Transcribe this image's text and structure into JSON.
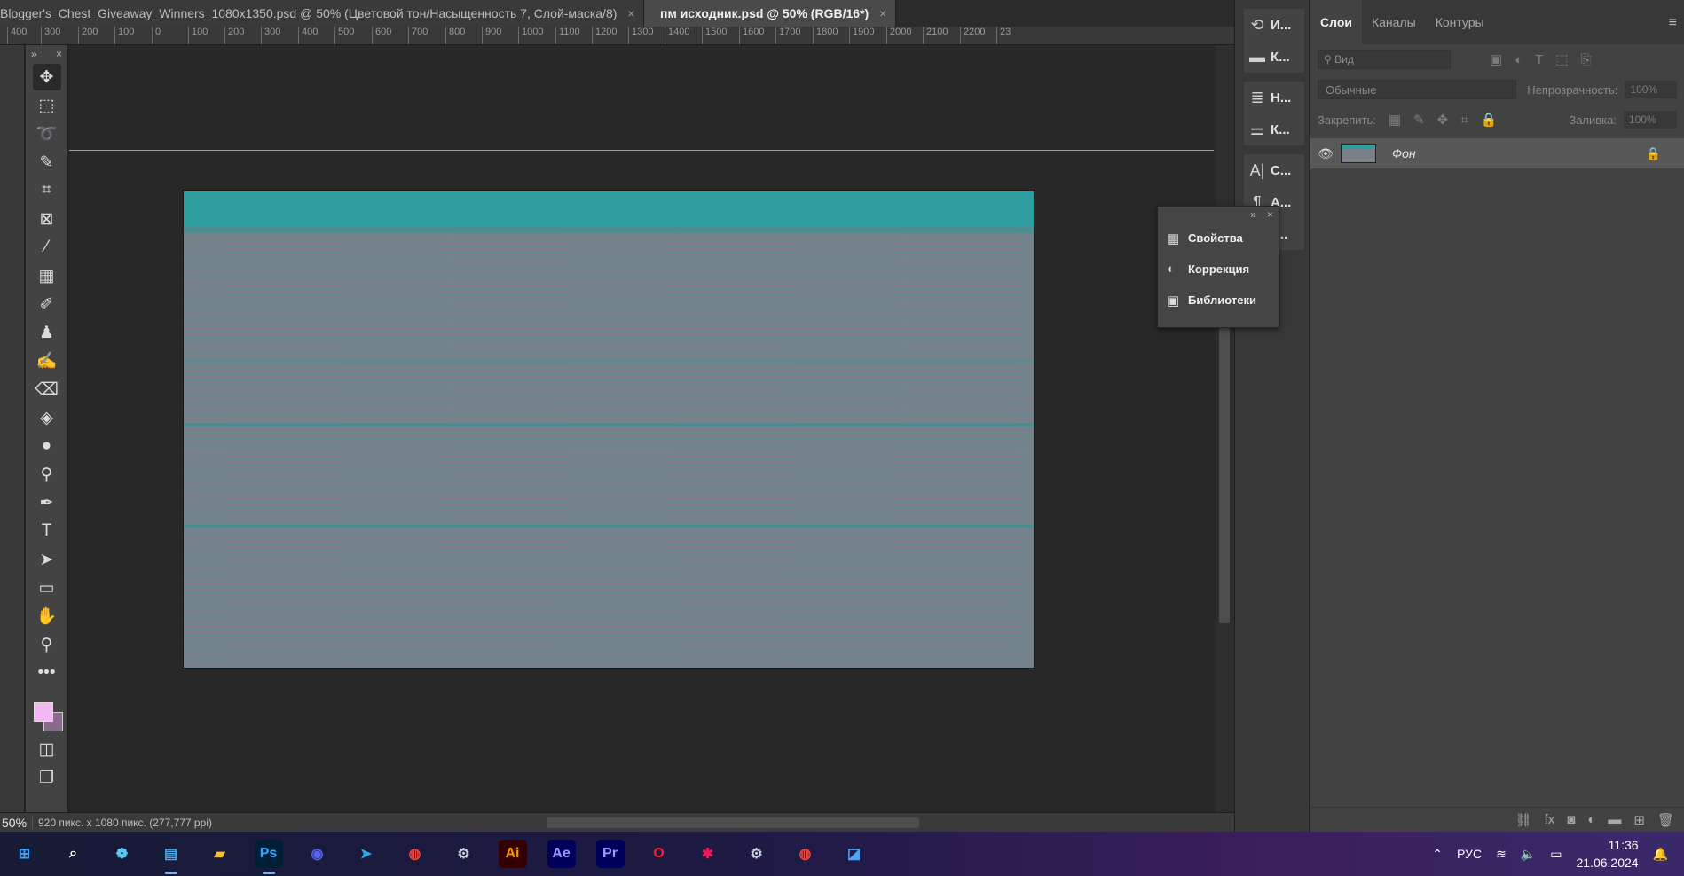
{
  "doc_tabs": [
    {
      "title": "Blogger's_Chest_Giveaway_Winners_1080x1350.psd @ 50% (Цветовой тон/Насыщенность 7, Слой-маска/8)",
      "active": false
    },
    {
      "title": "пм исходник.psd @ 50% (RGB/16*)",
      "active": true
    }
  ],
  "ruler_ticks": [
    "400",
    "300",
    "200",
    "100",
    "0",
    "100",
    "200",
    "300",
    "400",
    "500",
    "600",
    "700",
    "800",
    "900",
    "1000",
    "1100",
    "1200",
    "1300",
    "1400",
    "1500",
    "1600",
    "1700",
    "1800",
    "1900",
    "2000",
    "2100",
    "2200",
    "23"
  ],
  "status": {
    "zoom": "50%",
    "info": "920 пикс. x 1080 пикс. (277,777 ppi)"
  },
  "icon_panel": [
    {
      "icon": "history-icon",
      "glyph": "⟲",
      "label": "И..."
    },
    {
      "icon": "comments-icon",
      "glyph": "▬",
      "label": "К..."
    },
    {
      "icon": "brush-settings-icon",
      "glyph": "≣",
      "label": "Н..."
    },
    {
      "icon": "brush-presets-icon",
      "glyph": "⚌",
      "label": "К..."
    },
    {
      "icon": "character-icon",
      "glyph": "A|",
      "label": "С..."
    },
    {
      "icon": "paragraph-icon",
      "glyph": "¶",
      "label": "А..."
    },
    {
      "icon": "glyphs-icon",
      "glyph": "◈",
      "label": "Г..."
    }
  ],
  "popup": [
    {
      "icon": "properties-icon",
      "glyph": "▦",
      "label": "Свойства"
    },
    {
      "icon": "adjustments-icon",
      "glyph": "◐",
      "label": "Коррекция"
    },
    {
      "icon": "libraries-icon",
      "glyph": "▣",
      "label": "Библиотеки"
    }
  ],
  "layers_panel": {
    "tabs": [
      "Слои",
      "Каналы",
      "Контуры"
    ],
    "search_placeholder": "Вид",
    "blend_mode": "Обычные",
    "opacity_label": "Непрозрачность:",
    "opacity_value": "100%",
    "lock_label": "Закрепить:",
    "fill_label": "Заливка:",
    "fill_value": "100%",
    "layers": [
      {
        "name": "Фон",
        "visible": true,
        "locked": true
      }
    ]
  },
  "taskbar": {
    "language": "РУС",
    "time": "11:36",
    "date": "21.06.2024",
    "apps": [
      {
        "name": "start",
        "glyph": "⊞",
        "color": "#3aa0ff"
      },
      {
        "name": "search",
        "glyph": "⌕",
        "color": "#ffffff"
      },
      {
        "name": "widgets",
        "glyph": "❁",
        "color": "#5ac8f0"
      },
      {
        "name": "notepad",
        "glyph": "▤",
        "color": "#4aa8e8"
      },
      {
        "name": "explorer",
        "glyph": "▰",
        "color": "#f4c430"
      },
      {
        "name": "photoshop",
        "glyph": "Ps",
        "color": "#31a8ff"
      },
      {
        "name": "discord",
        "glyph": "◉",
        "color": "#5865f2"
      },
      {
        "name": "telegram",
        "glyph": "➤",
        "color": "#2aabee"
      },
      {
        "name": "chrome",
        "glyph": "◍",
        "color": "#e8453c"
      },
      {
        "name": "steam",
        "glyph": "⚙",
        "color": "#c7d5e0"
      },
      {
        "name": "illustrator",
        "glyph": "Ai",
        "color": "#ff9a00"
      },
      {
        "name": "after-effects",
        "glyph": "Ae",
        "color": "#9999ff"
      },
      {
        "name": "premiere",
        "glyph": "Pr",
        "color": "#9999ff"
      },
      {
        "name": "opera",
        "glyph": "O",
        "color": "#ff1b2d"
      },
      {
        "name": "slack",
        "glyph": "✱",
        "color": "#e01e5a"
      },
      {
        "name": "steam-2",
        "glyph": "⚙",
        "color": "#c7d5e0"
      },
      {
        "name": "chrome-2",
        "glyph": "◍",
        "color": "#e8453c"
      },
      {
        "name": "paint",
        "glyph": "◪",
        "color": "#4fa3f7"
      }
    ]
  },
  "colors": {
    "accent": "#31a8ff",
    "guide": "#40c8c8",
    "foreground": "#f3b8f3"
  }
}
